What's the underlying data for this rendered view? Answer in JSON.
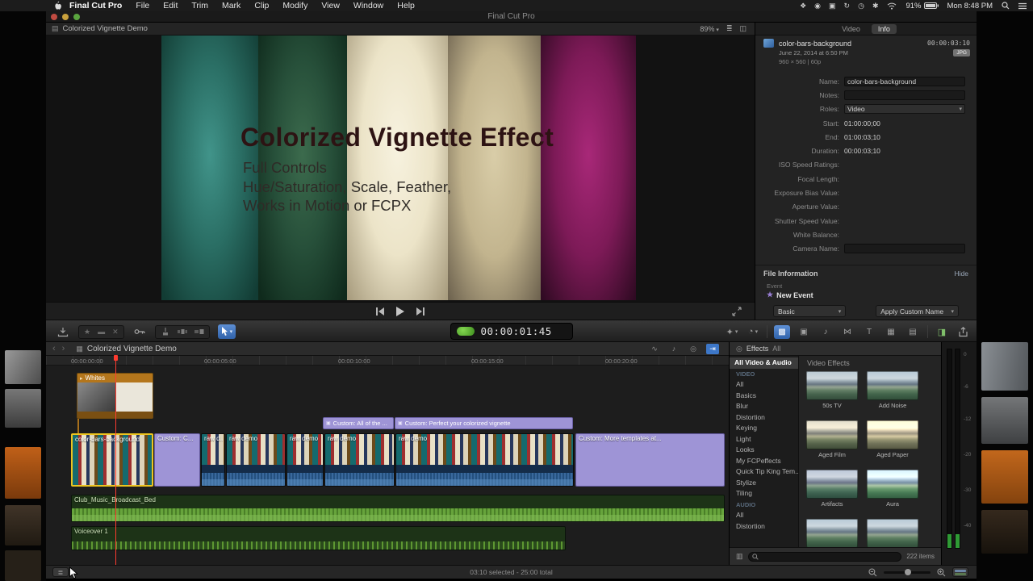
{
  "menubar": {
    "app_name": "Final Cut Pro",
    "items": [
      "File",
      "Edit",
      "Trim",
      "Mark",
      "Clip",
      "Modify",
      "View",
      "Window",
      "Help"
    ],
    "status_icons": [
      {
        "name": "menu-extra-1-icon",
        "glyph": "❖"
      },
      {
        "name": "menu-extra-2-icon",
        "glyph": "◉"
      },
      {
        "name": "display-icon",
        "glyph": "▣"
      },
      {
        "name": "sync-icon",
        "glyph": "↻"
      },
      {
        "name": "time-machine-icon",
        "glyph": "◷"
      },
      {
        "name": "bluetooth-icon",
        "glyph": "✱"
      }
    ],
    "battery": "91%",
    "clock": "Mon 8:48 PM"
  },
  "window": {
    "title": "Final Cut Pro"
  },
  "viewer": {
    "project_title": "Colorized Vignette Demo",
    "zoom": "89%",
    "slide": {
      "title": "Colorized Vignette Effect",
      "lines": [
        "Full Controls",
        "Hue/Saturation, Scale, Feather,",
        "Works in Motion or FCPX"
      ]
    }
  },
  "inspector": {
    "tabs": [
      "Video",
      "Info"
    ],
    "active_tab": "Info",
    "clip_name": "color-bars-background",
    "clip_timecode": "00:00:03:10",
    "clip_date": "June 22, 2014 at 6:50 PM",
    "clip_badge": "JPG",
    "clip_format": "960 × 560  |  60p",
    "fields": [
      {
        "label": "Name:",
        "value": "color-bars-background",
        "type": "input"
      },
      {
        "label": "Notes:",
        "value": "",
        "type": "input"
      },
      {
        "label": "Roles:",
        "value": "Video",
        "type": "select"
      },
      {
        "label": "Start:",
        "value": "01:00:00;00",
        "type": "text"
      },
      {
        "label": "End:",
        "value": "01:00:03;10",
        "type": "text"
      },
      {
        "label": "Duration:",
        "value": "00:00:03;10",
        "type": "text"
      },
      {
        "label": "ISO Speed Ratings:",
        "value": "",
        "type": "text"
      },
      {
        "label": "Focal Length:",
        "value": "",
        "type": "text"
      },
      {
        "label": "Exposure Bias Value:",
        "value": "",
        "type": "text"
      },
      {
        "label": "Aperture Value:",
        "value": "",
        "type": "text"
      },
      {
        "label": "Shutter Speed Value:",
        "value": "",
        "type": "text"
      },
      {
        "label": "White Balance:",
        "value": "",
        "type": "text"
      },
      {
        "label": "Camera Name:",
        "value": "",
        "type": "input"
      }
    ],
    "file_information": {
      "title": "File Information",
      "hide_label": "Hide",
      "event_label": "Event",
      "event_name": "New Event"
    },
    "footer": {
      "left_dropdown": "Basic",
      "right_dropdown": "Apply Custom Name"
    }
  },
  "toolbar": {
    "timecode": "00:00:01:45",
    "browsers": [
      {
        "name": "effects-browser-button",
        "glyph": "▩",
        "active": true
      },
      {
        "name": "photos-browser-button",
        "glyph": "▣",
        "active": false
      },
      {
        "name": "music-browser-button",
        "glyph": "♪",
        "active": false
      },
      {
        "name": "transitions-browser-button",
        "glyph": "⋈",
        "active": false
      },
      {
        "name": "titles-browser-button",
        "glyph": "T",
        "active": false
      },
      {
        "name": "generators-browser-button",
        "glyph": "▦",
        "active": false
      },
      {
        "name": "themes-browser-button",
        "glyph": "▤",
        "active": false
      }
    ]
  },
  "timeline": {
    "title": "Colorized Vignette Demo",
    "ruler_labels": [
      "00:00:00:00",
      "00:00:05:00",
      "00:00:10:00",
      "00:00:15:00",
      "00:00:20:00"
    ],
    "toggles": [
      {
        "name": "clip-skimming-toggle",
        "glyph": "∿",
        "active": false
      },
      {
        "name": "audio-skimming-toggle",
        "glyph": "♪",
        "active": false
      },
      {
        "name": "solo-toggle",
        "glyph": "◎",
        "active": false
      },
      {
        "name": "snapping-toggle",
        "glyph": "⇥",
        "active": true
      }
    ],
    "connected_clip": {
      "name": "Whites"
    },
    "title_clips": [
      {
        "name": "Custom: All of the ..."
      },
      {
        "name": "Custom: Perfect your colorized vignette"
      }
    ],
    "storyline_clips": [
      {
        "name": "color-bars-background",
        "kind": "image",
        "selected": true
      },
      {
        "name": "Custom: C...",
        "kind": "title",
        "selected": false
      },
      {
        "name": "raw d...",
        "kind": "video",
        "selected": false
      },
      {
        "name": "raw demo",
        "kind": "video",
        "selected": false
      },
      {
        "name": "raw demo",
        "kind": "video",
        "selected": false
      },
      {
        "name": "raw demo",
        "kind": "video",
        "selected": false
      },
      {
        "name": "raw demo",
        "kind": "video",
        "selected": false
      },
      {
        "name": "Custom: More templates at...",
        "kind": "title",
        "selected": false
      }
    ],
    "audio_clips": [
      {
        "name": "Club_Music_Broadcast_Bed"
      },
      {
        "name": "Voiceover 1"
      }
    ]
  },
  "effects_browser": {
    "header": "Effects",
    "header_filter": "All",
    "selected_collection": "All Video & Audio",
    "video_section": "VIDEO",
    "video_items": [
      "All",
      "Basics",
      "Blur",
      "Distortion",
      "Keying",
      "Light",
      "Looks",
      "My FCPeffects",
      "Quick Tip King Tem...",
      "Stylize",
      "Tiling"
    ],
    "audio_section": "AUDIO",
    "audio_items": [
      "All",
      "Distortion"
    ],
    "grid_title": "Video Effects",
    "effects": [
      "50s TV",
      "Add Noise",
      "Aged Film",
      "Aged Paper",
      "Artifacts",
      "Aura",
      "",
      ""
    ],
    "item_count": "222 items",
    "search_placeholder": ""
  },
  "audio_meters": {
    "scale": [
      "0",
      "-6",
      "-12",
      "-20",
      "-30",
      "-40"
    ]
  },
  "statusbar": {
    "selection": "03:10 selected - 25:00 total"
  }
}
